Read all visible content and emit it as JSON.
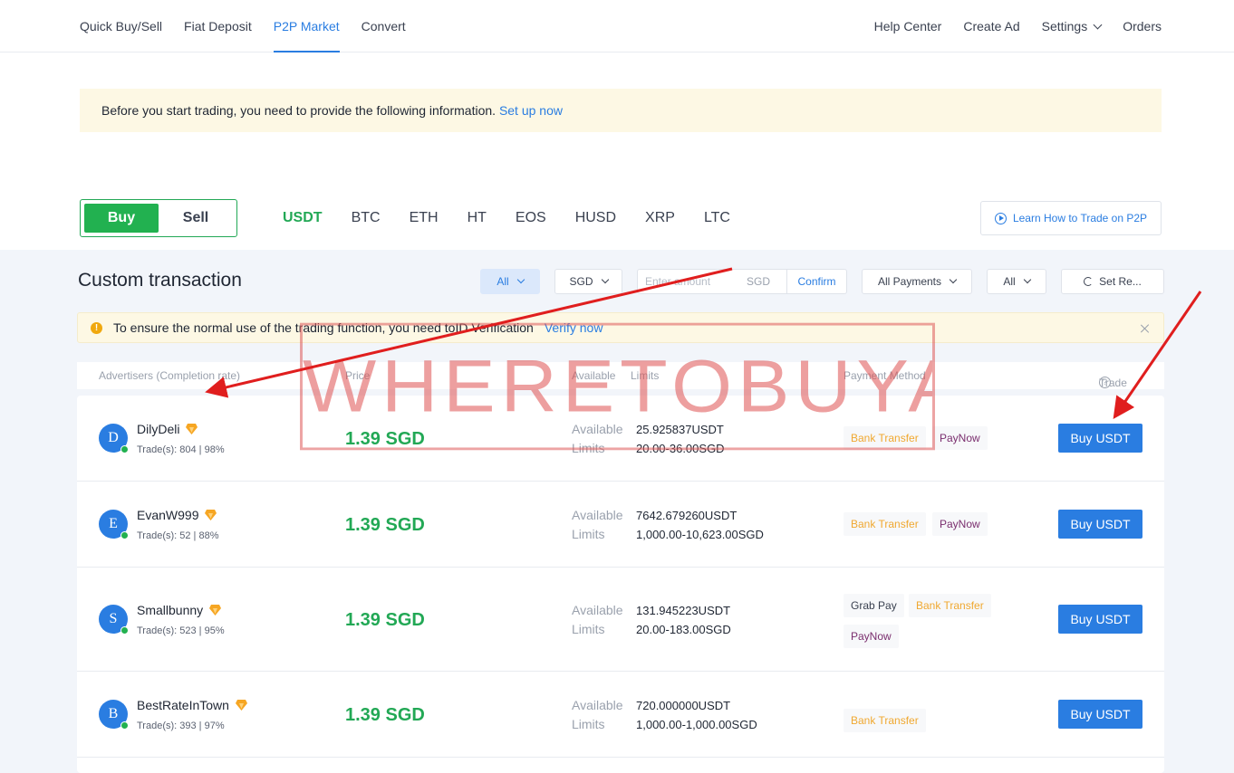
{
  "nav": {
    "left": [
      "Quick Buy/Sell",
      "Fiat Deposit",
      "P2P Market",
      "Convert"
    ],
    "active": "P2P Market",
    "help": "Help Center",
    "create_ad": "Create Ad",
    "settings": "Settings",
    "orders": "Orders"
  },
  "notice": {
    "text": "Before you start trading, you need to provide the following information.",
    "link": "Set up now"
  },
  "toggle": {
    "buy": "Buy",
    "sell": "Sell"
  },
  "coins": [
    "USDT",
    "BTC",
    "ETH",
    "HT",
    "EOS",
    "HUSD",
    "XRP",
    "LTC"
  ],
  "active_coin": "USDT",
  "learn": "Learn How to Trade on P2P",
  "section_title": "Custom transaction",
  "filters": {
    "all": "All",
    "currency": "SGD",
    "amount_placeholder": "Enter amount",
    "amount_unit": "SGD",
    "confirm": "Confirm",
    "payments": "All Payments",
    "all2": "All",
    "refresh": "Set Re..."
  },
  "warning": {
    "text": "To ensure the normal use of the trading function, you need toID Verification",
    "link": "Verify now"
  },
  "columns": [
    "Advertisers (Completion rate)",
    "Price",
    "Available",
    "Limits",
    "Payment Method",
    "Trade"
  ],
  "rows": [
    {
      "initial": "D",
      "name": "DilyDeli",
      "trades": "Trade(s): 804 | 98%",
      "price": "1.39 SGD",
      "available_label": "Available",
      "available": "25.925837USDT",
      "limits_label": "Limits",
      "limits": "20.00-36.00SGD",
      "payments": [
        "Bank Transfer",
        "PayNow"
      ],
      "action": "Buy USDT"
    },
    {
      "initial": "E",
      "name": "EvanW999",
      "trades": "Trade(s): 52 | 88%",
      "price": "1.39 SGD",
      "available_label": "Available",
      "available": "7642.679260USDT",
      "limits_label": "Limits",
      "limits": "1,000.00-10,623.00SGD",
      "payments": [
        "Bank Transfer",
        "PayNow"
      ],
      "action": "Buy USDT"
    },
    {
      "initial": "S",
      "name": "Smallbunny",
      "trades": "Trade(s): 523 | 95%",
      "price": "1.39 SGD",
      "available_label": "Available",
      "available": "131.945223USDT",
      "limits_label": "Limits",
      "limits": "20.00-183.00SGD",
      "payments": [
        "Grab Pay",
        "Bank Transfer",
        "PayNow"
      ],
      "action": "Buy USDT"
    },
    {
      "initial": "B",
      "name": "BestRateInTown",
      "trades": "Trade(s): 393 | 97%",
      "price": "1.39 SGD",
      "available_label": "Available",
      "available": "720.000000USDT",
      "limits_label": "Limits",
      "limits": "1,000.00-1,000.00SGD",
      "payments": [
        "Bank Transfer"
      ],
      "action": "Buy USDT"
    }
  ],
  "watermark": "WHERETOBUYALTS",
  "colors": {
    "accent": "#2a7de1",
    "green": "#22a855",
    "annotation": "#e01e1e"
  }
}
